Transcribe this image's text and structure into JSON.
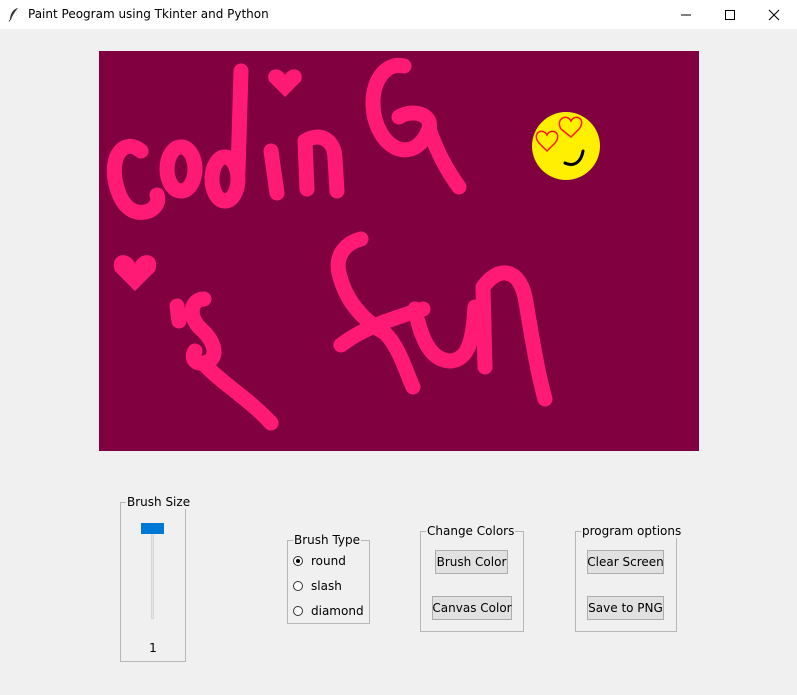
{
  "window": {
    "title": "Paint Peogram using Tkinter and Python",
    "icon": "feather-icon",
    "controls": [
      "minimize-icon",
      "maximize-icon",
      "close-icon"
    ]
  },
  "canvas": {
    "background_color": "#800040",
    "brush_color": "#ff1a75",
    "drawing_text": [
      "coding",
      "is",
      "fun"
    ],
    "emoji_color": "#ffef00"
  },
  "brush_size": {
    "label": "Brush Size",
    "value": "1",
    "slider_accent": "#0078d7"
  },
  "brush_type": {
    "label": "Brush Type",
    "options": [
      "round",
      "slash",
      "diamond"
    ],
    "selected": "round"
  },
  "change_colors": {
    "label": "Change Colors",
    "brush_color_button": "Brush Color",
    "canvas_color_button": "Canvas Color"
  },
  "program_options": {
    "label": "program options",
    "clear_button": "Clear Screen",
    "save_button": "Save to PNG"
  }
}
